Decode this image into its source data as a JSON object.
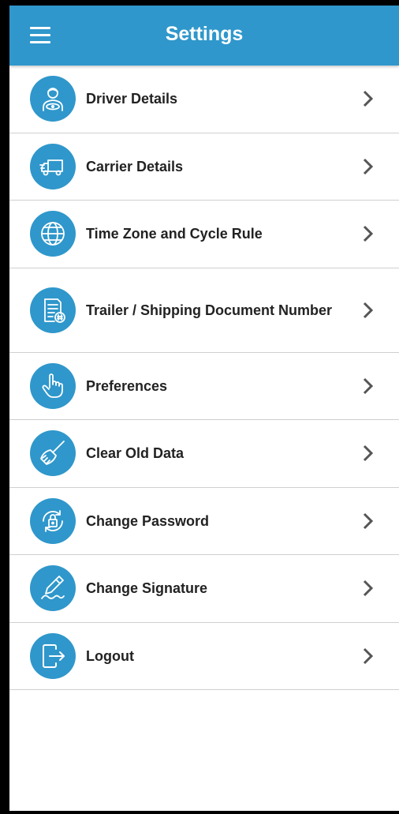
{
  "header": {
    "title": "Settings"
  },
  "items": [
    {
      "label": "Driver Details",
      "icon": "driver-icon"
    },
    {
      "label": "Carrier Details",
      "icon": "truck-icon"
    },
    {
      "label": "Time Zone and Cycle Rule",
      "icon": "globe-icon"
    },
    {
      "label": "Trailer / Shipping Document Number",
      "icon": "document-icon"
    },
    {
      "label": "Preferences",
      "icon": "hand-pointer-icon"
    },
    {
      "label": "Clear Old Data",
      "icon": "broom-icon"
    },
    {
      "label": "Change Password",
      "icon": "lock-refresh-icon"
    },
    {
      "label": "Change Signature",
      "icon": "signature-pen-icon"
    },
    {
      "label": "Logout",
      "icon": "logout-icon"
    }
  ],
  "colors": {
    "accent": "#2f97cb",
    "divider": "#cfcfcf",
    "text": "#222222"
  }
}
